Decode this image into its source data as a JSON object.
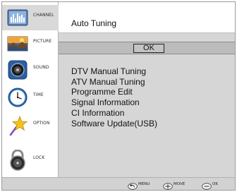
{
  "sidebar": {
    "items": [
      {
        "label": "CHANNEL",
        "icon": "channel-icon",
        "active": true
      },
      {
        "label": "PICTURE",
        "icon": "picture-icon",
        "active": false
      },
      {
        "label": "SOUND",
        "icon": "sound-icon",
        "active": false
      },
      {
        "label": "TIME",
        "icon": "clock-icon",
        "active": false
      },
      {
        "label": "OPTION",
        "icon": "star-icon",
        "active": false
      },
      {
        "label": "LOCK",
        "icon": "lock-icon",
        "active": false
      }
    ]
  },
  "main": {
    "title": "Auto Tuning",
    "ok_label": "OK",
    "items": [
      "DTV Manual Tuning",
      "ATV Manual Tuning",
      "Programme Edit",
      "Signal Information",
      "CI Information",
      "Software Update(USB)"
    ]
  },
  "footer": {
    "hints": [
      {
        "label": "MENU",
        "icon": "back-arrow-icon"
      },
      {
        "label": "MOVE",
        "icon": "dpad-icon"
      },
      {
        "label": "OK",
        "icon": "ok-key-icon"
      }
    ]
  },
  "colors": {
    "panel": "#d6d6d6",
    "highlight": "#bcbcbc",
    "active_item": "#d9d9d9"
  }
}
